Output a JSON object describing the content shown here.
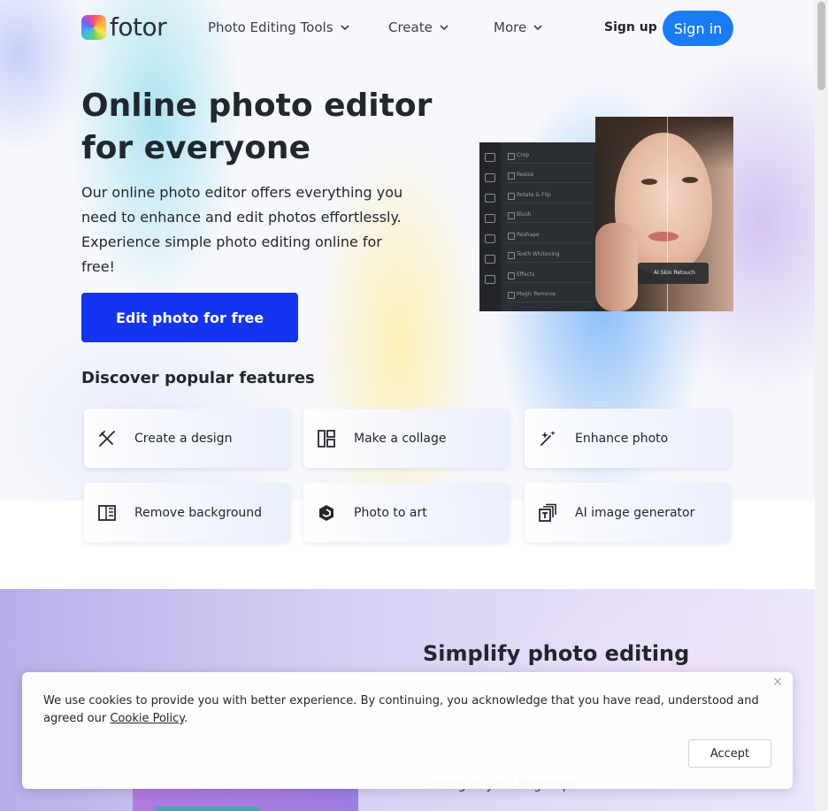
{
  "header": {
    "logo_text": "fotor",
    "nav": [
      {
        "label": "Photo Editing Tools"
      },
      {
        "label": "Create"
      },
      {
        "label": "More"
      }
    ],
    "sign_up": "Sign up",
    "sign_in": "Sign in"
  },
  "hero": {
    "title": "Online photo editor for everyone",
    "subtitle": "Our online photo editor offers everything you need to enhance and edit photos effortlessly. Experience simple photo editing online for free!",
    "cta": "Edit photo for free",
    "mockup": {
      "menu_items": [
        "Crop",
        "Resize",
        "Rotate & Flip",
        "Blush",
        "Reshape",
        "Teeth Whitening",
        "Effects",
        "Magic Remove"
      ],
      "badge": "AI Skin Retouch"
    }
  },
  "features": {
    "title": "Discover popular features",
    "items": [
      {
        "label": "Create a design",
        "icon": "design-icon"
      },
      {
        "label": "Make a collage",
        "icon": "collage-icon"
      },
      {
        "label": "Enhance photo",
        "icon": "enhance-icon"
      },
      {
        "label": "Remove background",
        "icon": "remove-background-icon"
      },
      {
        "label": "Photo to art",
        "icon": "photo-to-art-icon"
      },
      {
        "label": "AI image generator",
        "icon": "ai-image-generator-icon"
      }
    ]
  },
  "section2": {
    "title": "Simplify photo editing",
    "partial_text": "editing at your fingertips."
  },
  "cookie": {
    "text_before": "We use cookies to provide you with better experience. By continuing, you acknowledge that you have read, understood and agreed our ",
    "link": "Cookie Policy",
    "text_after": ".",
    "accept": "Accept",
    "close": "×"
  },
  "colors": {
    "sign_in_bg": "#1a7cf5",
    "cta_bg": "#1434f0",
    "text": "#22272e"
  }
}
